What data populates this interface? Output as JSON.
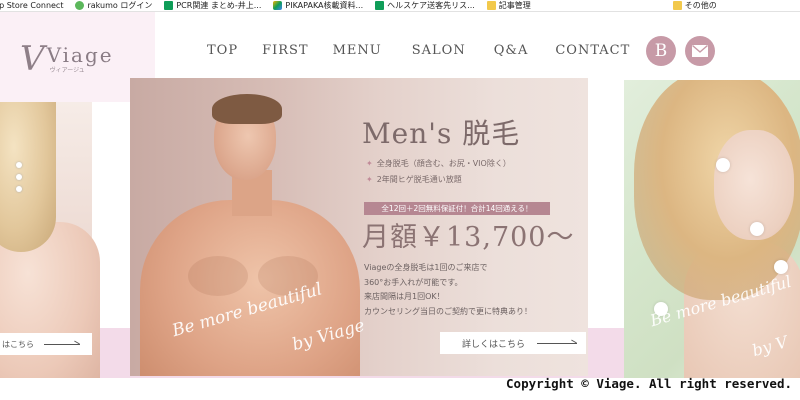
{
  "bookmarks": [
    {
      "label": "pp Store Connect",
      "icon": "app-store-icon",
      "color": "#ffffff"
    },
    {
      "label": "rakumo ログイン",
      "icon": "rakumo-icon",
      "color": "#4caf50"
    },
    {
      "label": "PCR関連 まとめ-井上...",
      "icon": "sheets-icon",
      "color": "#0f9d58"
    },
    {
      "label": "PIKAPAKA核載資料...",
      "icon": "drive-icon",
      "color": "#f4b400"
    },
    {
      "label": "ヘルスケア送客先リス...",
      "icon": "sheets-icon",
      "color": "#0f9d58"
    },
    {
      "label": "記事管理",
      "icon": "folder-icon",
      "color": "#f2c94c"
    },
    {
      "label": "その他の",
      "icon": "folder-icon",
      "color": "#f2c94c"
    }
  ],
  "logo": {
    "mark": "V",
    "word": "Viage",
    "sub": "ヴィアージュ"
  },
  "nav": [
    "TOP",
    "FIRST",
    "MENU",
    "SALON",
    "Q&A",
    "CONTACT"
  ],
  "social": {
    "blog_letter": "B",
    "mail_icon": "mail-icon"
  },
  "slides": {
    "left": {
      "button_label": "はこちら"
    },
    "main": {
      "title": "Men's 脱毛",
      "bullets": [
        "全身脱毛（顔含む、お尻・VIO除く）",
        "2年間ヒゲ脱毛通い放題"
      ],
      "tag": "全12回＋2回無料保証付！合計14回通える！",
      "price": "月額￥13,700～",
      "description": [
        "Viageの全身脱毛は1回のご来店で",
        "360°お手入れが可能です。",
        "来店間隔は月1回OK！",
        "カウンセリング当日のご契約で更に特典あり！"
      ],
      "button_label": "詳しくはこちら",
      "script_line1": "Be more beautiful",
      "script_line2": "by Viage"
    },
    "right": {
      "script_line1": "Be more beautiful",
      "script_line2": "by V"
    }
  },
  "colors": {
    "accent_pink": "#c79aa7",
    "band_pink": "#f3dbe9",
    "tag_bg": "#b68792"
  },
  "footer": {
    "copyright": "Copyright © Viage. All right reserved."
  }
}
